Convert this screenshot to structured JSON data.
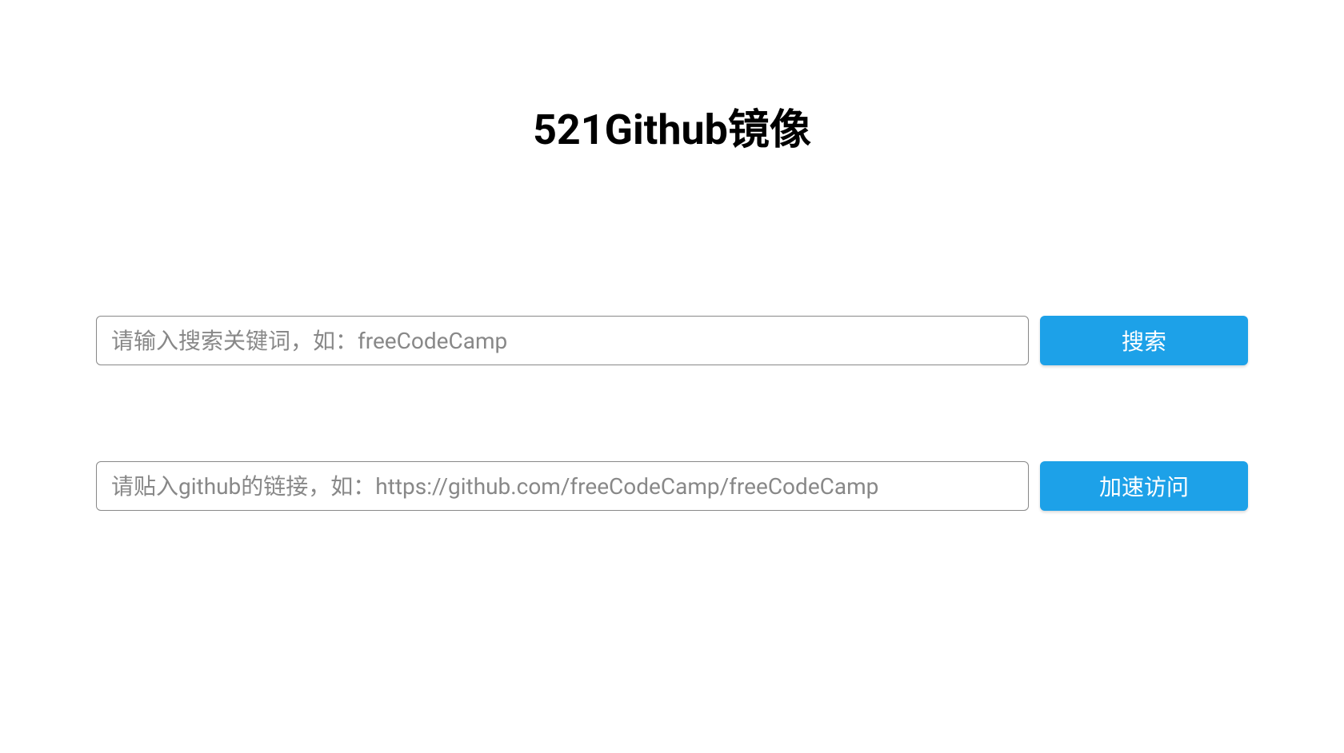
{
  "title": "521Github镜像",
  "search": {
    "input_placeholder": "请输入搜索关键词，如：freeCodeCamp",
    "input_value": "",
    "button_label": "搜索"
  },
  "accelerate": {
    "input_placeholder": "请贴入github的链接，如：https://github.com/freeCodeCamp/freeCodeCamp",
    "input_value": "",
    "button_label": "加速访问"
  }
}
